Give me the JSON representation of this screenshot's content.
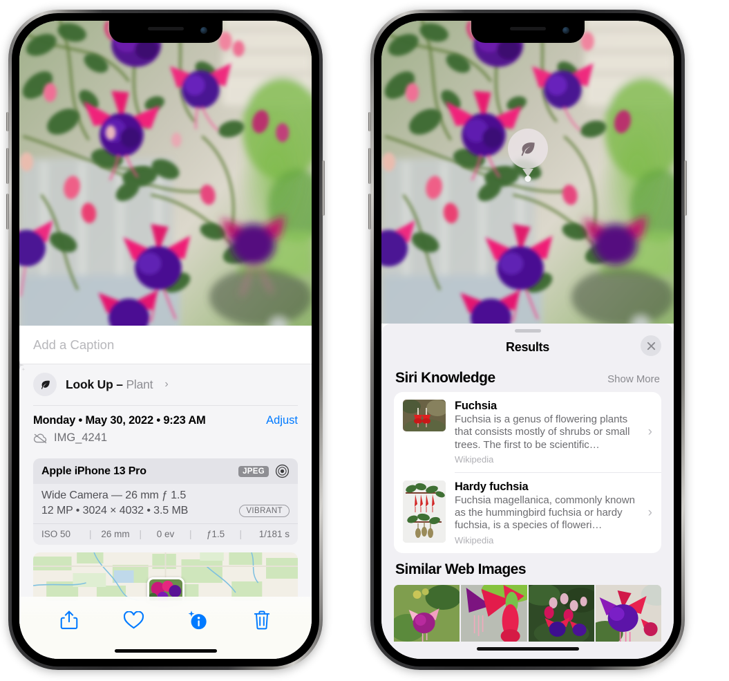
{
  "left_phone": {
    "caption_placeholder": "Add a Caption",
    "lookup": {
      "label": "Look Up",
      "dash": " – ",
      "subject": "Plant",
      "chevron": "›"
    },
    "meta": {
      "date": "Monday • May 30, 2022 • 9:23 AM",
      "adjust_label": "Adjust",
      "filename": "IMG_4241"
    },
    "camera_card": {
      "model": "Apple iPhone 13 Pro",
      "format_badge": "JPEG",
      "lens": "Wide Camera — 26 mm ƒ 1.5",
      "resolution": "12 MP • 3024 × 4032 • 3.5 MB",
      "style_badge": "VIBRANT",
      "exif": [
        "ISO 50",
        "26 mm",
        "0 ev",
        "ƒ1.5",
        "1/181 s"
      ]
    },
    "toolbar": {
      "share_label": "share-icon",
      "favorite_label": "heart-icon",
      "info_label": "info-icon",
      "delete_label": "trash-icon"
    }
  },
  "right_phone": {
    "sheet_title": "Results",
    "close_label": "✕",
    "siri_knowledge": {
      "title": "Siri Knowledge",
      "action": "Show More",
      "items": [
        {
          "title": "Fuchsia",
          "description": "Fuchsia is a genus of flowering plants that consists mostly of shrubs or small trees. The first to be scientific…",
          "source": "Wikipedia",
          "chevron": "›"
        },
        {
          "title": "Hardy fuchsia",
          "description": "Fuchsia magellanica, commonly known as the hummingbird fuchsia or hardy fuchsia, is a species of floweri…",
          "source": "Wikipedia",
          "chevron": "›"
        }
      ]
    },
    "similar_web_images": {
      "title": "Similar Web Images",
      "tiles": [
        "fuchsia-web-image-1",
        "fuchsia-web-image-2",
        "fuchsia-web-image-3",
        "fuchsia-web-image-4"
      ]
    },
    "lens_badge": "leaf-icon"
  },
  "colors": {
    "accent_blue": "#007aff",
    "sheet_gray": "#f1f0f4",
    "card_gray": "#ececf0",
    "secondary_text": "#6e6e73"
  }
}
